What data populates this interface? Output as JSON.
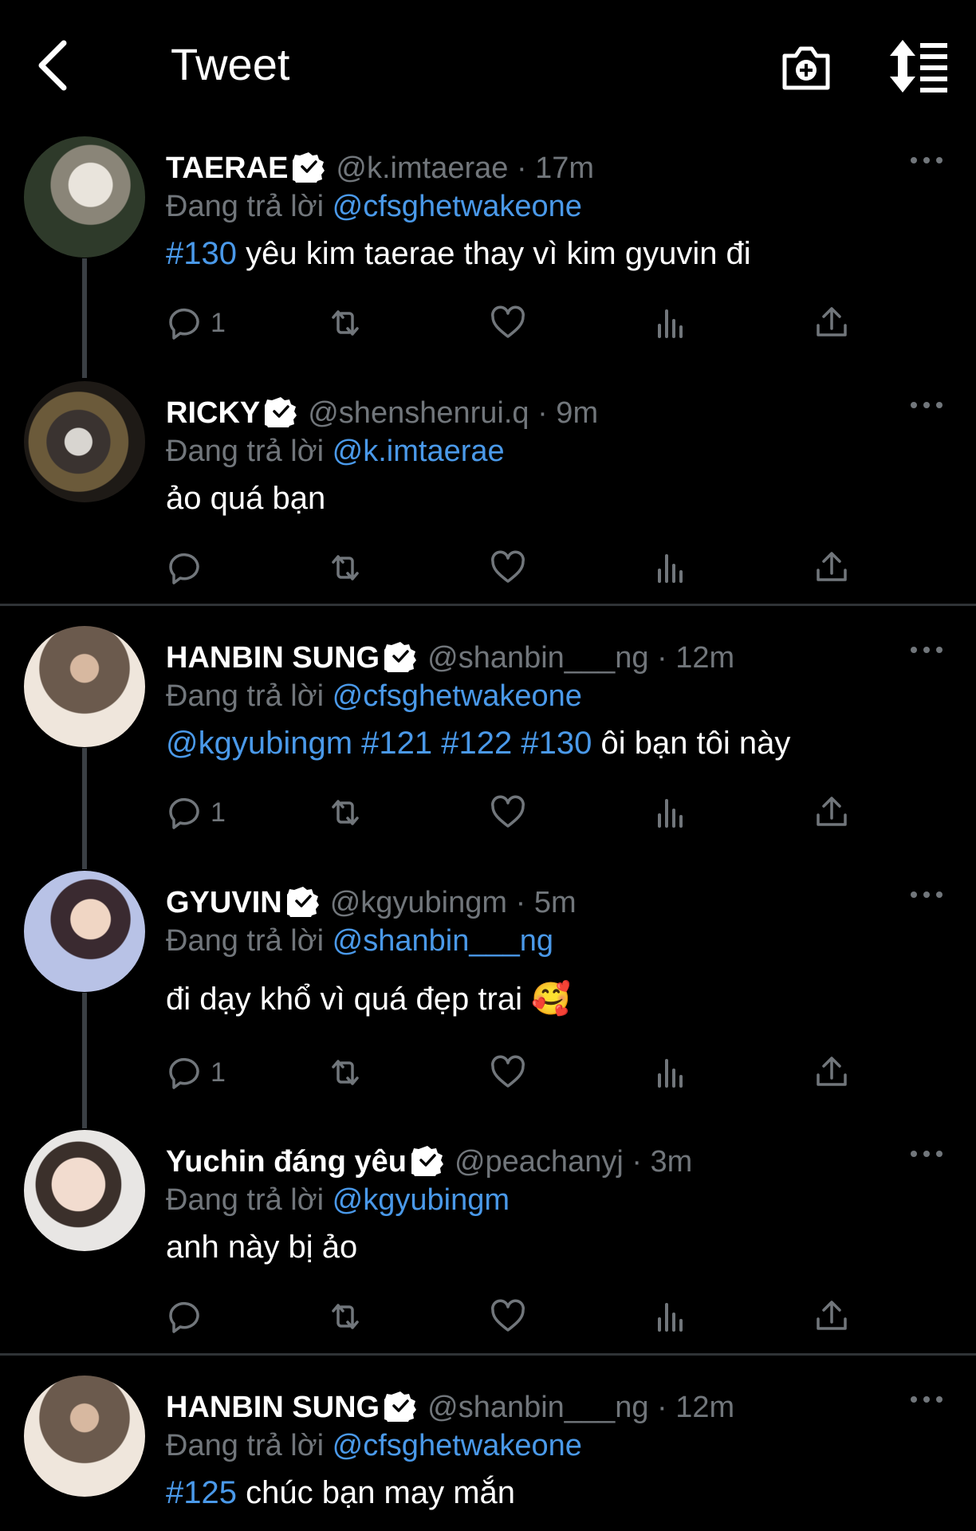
{
  "header": {
    "title": "Tweet"
  },
  "colors": {
    "background": "#000000",
    "accent": "#4a99e9",
    "muted": "#71767b"
  },
  "tweets": [
    {
      "name": "TAERAE",
      "handle": "@k.imtaerae · 17m",
      "reply_prefix": "Đang trả lời",
      "reply_to": "@cfsghetwakeone",
      "tag": "#130",
      "text": " yêu kim taerae thay vì kim gyuvin đi",
      "reply_count": "1"
    },
    {
      "name": "RICKY",
      "handle": "@shenshenrui.q · 9m",
      "reply_prefix": "Đang trả lời",
      "reply_to": "@k.imtaerae",
      "tag": "",
      "text": "ảo quá bạn",
      "reply_count": ""
    },
    {
      "name": "HANBIN SUNG",
      "handle": "@shanbin___ng · 12m",
      "reply_prefix": "Đang trả lời",
      "reply_to": "@cfsghetwakeone",
      "tag": "@kgyubingm #121 #122 #130",
      "text": " ôi bạn tôi này",
      "reply_count": "1"
    },
    {
      "name": "GYUVIN",
      "handle": "@kgyubingm · 5m",
      "reply_prefix": "Đang trả lời",
      "reply_to": "@shanbin___ng",
      "tag": "",
      "text": "đi dạy khổ vì quá đẹp trai 🥰",
      "reply_count": "1"
    },
    {
      "name": "Yuchin đáng yêu",
      "handle": "@peachanyj · 3m",
      "reply_prefix": "Đang trả lời",
      "reply_to": "@kgyubingm",
      "tag": "",
      "text": "anh này bị ảo",
      "reply_count": ""
    },
    {
      "name": "HANBIN SUNG",
      "handle": "@shanbin___ng · 12m",
      "reply_prefix": "Đang trả lời",
      "reply_to": "@cfsghetwakeone",
      "tag": "#125",
      "text": " chúc bạn may mắn",
      "reply_count": ""
    }
  ]
}
